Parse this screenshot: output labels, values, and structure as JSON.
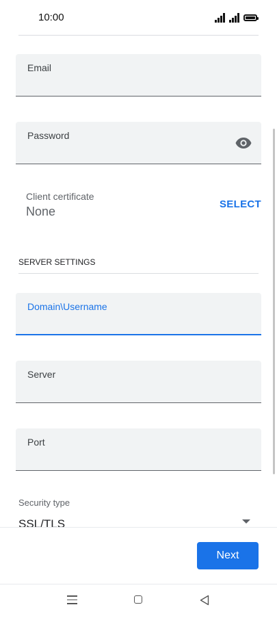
{
  "status_bar": {
    "time": "10:00"
  },
  "account_fields": {
    "email_label": "Email",
    "password_label": "Password"
  },
  "client_certificate": {
    "label": "Client certificate",
    "value": "None",
    "action": "SELECT"
  },
  "server_settings": {
    "header": "SERVER SETTINGS",
    "domain_username_label": "Domain\\Username",
    "server_label": "Server",
    "port_label": "Port",
    "security_type_label": "Security type",
    "security_type_value": "SSL/TLS"
  },
  "footer": {
    "next_label": "Next"
  },
  "colors": {
    "accent": "#1a73e8",
    "field_background": "#f1f3f4"
  },
  "icons": {
    "password_toggle": "eye-icon",
    "dropdown": "dropdown-arrow-icon",
    "nav_menu": "menu-icon",
    "nav_home": "home-icon",
    "nav_back": "back-icon"
  }
}
